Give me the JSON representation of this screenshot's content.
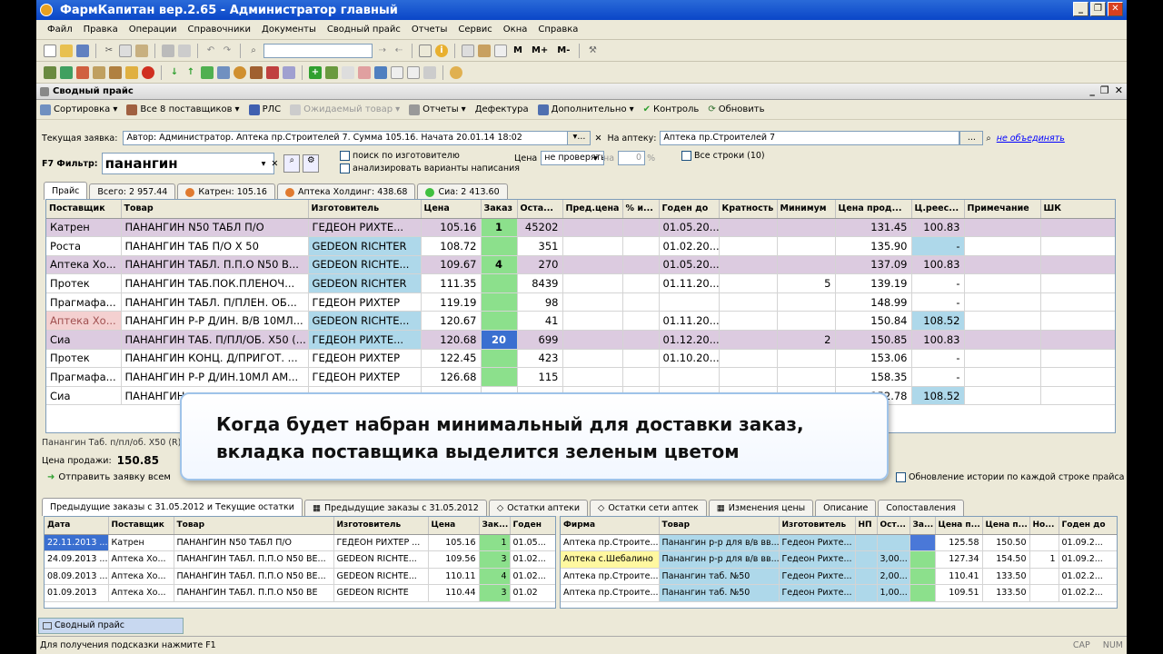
{
  "window": {
    "title": "ФармКапитан вер.2.65 - Администратор главный"
  },
  "menu": [
    "Файл",
    "Правка",
    "Операции",
    "Справочники",
    "Документы",
    "Сводный прайс",
    "Отчеты",
    "Сервис",
    "Окна",
    "Справка"
  ],
  "toolbar": {
    "m1": "M",
    "m2": "M+",
    "m3": "M-"
  },
  "doc": {
    "title": "Сводный прайс"
  },
  "commands": {
    "sort": "Сортировка",
    "all_suppliers": "Все 8 поставщиков",
    "rls": "РЛС",
    "expected": "Ожидаемый товар",
    "reports": "Отчеты",
    "defect": "Дефектура",
    "extra": "Дополнительно",
    "control": "Контроль",
    "refresh": "Обновить"
  },
  "order_line": {
    "label": "Текущая заявка:",
    "value": "Автор: Администратор. Аптека пр.Строителей 7. Сумма 105.16. Начата 20.01.14 18:02",
    "pharmacy_label": "На аптеку:",
    "pharmacy_value": "Аптека пр.Строителей 7",
    "no_merge": "не объединять"
  },
  "filter": {
    "label": "F7 Фильтр:",
    "value": "панангин",
    "search_by_maker": "поиск по изготовителю",
    "analyze_variants": "анализировать варианты написания",
    "price_label": "Цена",
    "price_mode": "не проверять",
    "on_label": "на",
    "percent_value": "0",
    "percent_sign": "%",
    "all_rows": "Все строки (10)"
  },
  "tabs": [
    {
      "label": "Прайс",
      "dot": ""
    },
    {
      "label": "Всего: 2 957.44",
      "dot": ""
    },
    {
      "label": "Катрен: 105.16",
      "dot": "#e07a30"
    },
    {
      "label": "Аптека Холдинг: 438.68",
      "dot": "#e07a30"
    },
    {
      "label": "Сиа: 2 413.60",
      "dot": "#40c040"
    }
  ],
  "main_table": {
    "headers": [
      "Поставщик",
      "Товар",
      "Изготовитель",
      "Цена",
      "Заказ",
      "Оста...",
      "Пред.цена",
      "% и...",
      "Годен до",
      "Кратность",
      "Минимум",
      "Цена прод...",
      "Ц.реес...",
      "Примечание",
      "ШК"
    ],
    "rows": [
      {
        "supplier": "Катрен",
        "product": "ПАНАНГИН N50 ТАБЛ П/О",
        "maker": "ГЕДЕОН РИХТЕ...",
        "price": "105.16",
        "order": "1",
        "stock": "45202",
        "prev": "",
        "pct": "",
        "expiry": "01.05.20...",
        "mult": "",
        "min": "",
        "sale": "131.45",
        "reg": "100.83",
        "note": "",
        "bc": ""
      },
      {
        "supplier": "Роста",
        "product": "ПАНАНГИН ТАБ П/О Х 50",
        "maker": "GEDEON RICHTER",
        "price": "108.72",
        "order": "",
        "stock": "351",
        "prev": "",
        "pct": "",
        "expiry": "01.02.20...",
        "mult": "",
        "min": "",
        "sale": "135.90",
        "reg": "-",
        "note": "",
        "bc": ""
      },
      {
        "supplier": "Аптека Хо...",
        "product": "ПАНАНГИН ТАБЛ. П.П.О N50 В...",
        "maker": "GEDEON RICHTE...",
        "price": "109.67",
        "order": "4",
        "stock": "270",
        "prev": "",
        "pct": "",
        "expiry": "01.05.20...",
        "mult": "",
        "min": "",
        "sale": "137.09",
        "reg": "100.83",
        "note": "",
        "bc": ""
      },
      {
        "supplier": "Протек",
        "product": "ПАНАНГИН ТАБ.ПОК.ПЛЕНОЧ...",
        "maker": "GEDEON RICHTER",
        "price": "111.35",
        "order": "",
        "stock": "8439",
        "prev": "",
        "pct": "",
        "expiry": "01.11.20...",
        "mult": "",
        "min": "5",
        "sale": "139.19",
        "reg": "-",
        "note": "",
        "bc": ""
      },
      {
        "supplier": "Прагмафа...",
        "product": "ПАНАНГИН ТАБЛ. П/ПЛЕН. ОБ...",
        "maker": "ГЕДЕОН РИХТЕР",
        "price": "119.19",
        "order": "",
        "stock": "98",
        "prev": "",
        "pct": "",
        "expiry": "",
        "mult": "",
        "min": "",
        "sale": "148.99",
        "reg": "-",
        "note": "",
        "bc": ""
      },
      {
        "supplier": "Аптека Хо...",
        "product": "ПАНАНГИН Р-Р Д/ИН. В/В 10МЛ...",
        "maker": "GEDEON RICHTE...",
        "price": "120.67",
        "order": "",
        "stock": "41",
        "prev": "",
        "pct": "",
        "expiry": "01.11.20...",
        "mult": "",
        "min": "",
        "sale": "150.84",
        "reg": "108.52",
        "note": "",
        "bc": ""
      },
      {
        "supplier": "Сиа",
        "product": "ПАНАНГИН ТАБ. П/ПЛ/ОБ. Х50 (...",
        "maker": "ГЕДЕОН РИХТЕ...",
        "price": "120.68",
        "order": "20",
        "stock": "699",
        "prev": "",
        "pct": "",
        "expiry": "01.12.20...",
        "mult": "",
        "min": "2",
        "sale": "150.85",
        "reg": "100.83",
        "note": "",
        "bc": ""
      },
      {
        "supplier": "Протек",
        "product": "ПАНАНГИН КОНЦ. Д/ПРИГОТ. ...",
        "maker": "ГЕДЕОН РИХТЕР",
        "price": "122.45",
        "order": "",
        "stock": "423",
        "prev": "",
        "pct": "",
        "expiry": "01.10.20...",
        "mult": "",
        "min": "",
        "sale": "153.06",
        "reg": "-",
        "note": "",
        "bc": ""
      },
      {
        "supplier": "Прагмафа...",
        "product": "ПАНАНГИН Р-Р Д/ИН.10МЛ АМ...",
        "maker": "ГЕДЕОН РИХТЕР",
        "price": "126.68",
        "order": "",
        "stock": "115",
        "prev": "",
        "pct": "",
        "expiry": "",
        "mult": "",
        "min": "",
        "sale": "158.35",
        "reg": "-",
        "note": "",
        "bc": ""
      },
      {
        "supplier": "Сиа",
        "product": "ПАНАНГИН",
        "maker": "",
        "price": "",
        "order": "",
        "stock": "",
        "prev": "",
        "pct": "",
        "expiry": "",
        "mult": "",
        "min": "",
        "sale": "152.78",
        "reg": "108.52",
        "note": "",
        "bc": ""
      }
    ]
  },
  "details": {
    "product_line": "Панангин Таб. п/пл/об. Х50 (R)",
    "sale_price_label": "Цена продажи:",
    "sale_price_value": "150.85",
    "send_order": "Отправить заявку всем",
    "history_update": "Обновление истории по каждой строке прайса"
  },
  "callout": {
    "line1": "Когда будет набран минимальный для доставки заказ,",
    "line2": "вкладка поставщика выделится зеленым цветом"
  },
  "bottom_tabs": [
    "Предыдущие заказы с 31.05.2012 и Текущие остатки",
    "Предыдущие заказы с 31.05.2012",
    "Остатки аптеки",
    "Остатки сети аптек",
    "Изменения цены",
    "Описание",
    "Сопоставления"
  ],
  "history_table": {
    "headers": [
      "Дата",
      "Поставщик",
      "Товар",
      "Изготовитель",
      "Цена",
      "Зак...",
      "Годен"
    ],
    "rows": [
      [
        "22.11.2013 ...",
        "Катрен",
        "ПАНАНГИН N50 ТАБЛ П/О",
        "ГЕДЕОН РИХТЕР ...",
        "105.16",
        "1",
        "01.05..."
      ],
      [
        "24.09.2013 ...",
        "Аптека Хо...",
        "ПАНАНГИН ТАБЛ. П.П.О N50 ВЕ...",
        "GEDEON RICHTE...",
        "109.56",
        "3",
        "01.02..."
      ],
      [
        "08.09.2013 ...",
        "Аптека Хо...",
        "ПАНАНГИН ТАБЛ. П.П.О N50 ВЕ...",
        "GEDEON RICHTE...",
        "110.11",
        "4",
        "01.02..."
      ],
      [
        "01.09.2013",
        "Аптека Хо...",
        "ПАНАНГИН ТАБЛ. П.П.О N50 ВЕ",
        "GEDEON RICHTE",
        "110.44",
        "3",
        "01.02"
      ]
    ]
  },
  "stock_table": {
    "headers": [
      "Фирма",
      "Товар",
      "Изготовитель",
      "НП",
      "Ост...",
      "За...",
      "Цена п...",
      "Цена п...",
      "Но...",
      "Годен до"
    ],
    "rows": [
      [
        "Аптека пр.Строите...",
        "Панангин р-р для в/в вв...",
        "Гедеон Рихте...",
        "",
        "",
        "",
        "125.58",
        "150.50",
        "",
        "01.09.2..."
      ],
      [
        "Аптека с.Шебалино",
        "Панангин р-р для в/в вв...",
        "Гедеон Рихте...",
        "",
        "3,00...",
        "",
        "127.34",
        "154.50",
        "1",
        "01.09.2..."
      ],
      [
        "Аптека пр.Строите...",
        "Панангин таб. №50",
        "Гедеон Рихте...",
        "",
        "2,00...",
        "",
        "110.41",
        "133.50",
        "",
        "01.02.2..."
      ],
      [
        "Аптека пр.Строите...",
        "Панангин таб. №50",
        "Гедеон Рихте...",
        "",
        "1,00...",
        "",
        "109.51",
        "133.50",
        "",
        "01.02.2..."
      ]
    ]
  },
  "taskbar": {
    "item": "Сводный прайс"
  },
  "status": {
    "hint": "Для получения подсказки нажмите F1",
    "cap": "CAP",
    "num": "NUM"
  }
}
